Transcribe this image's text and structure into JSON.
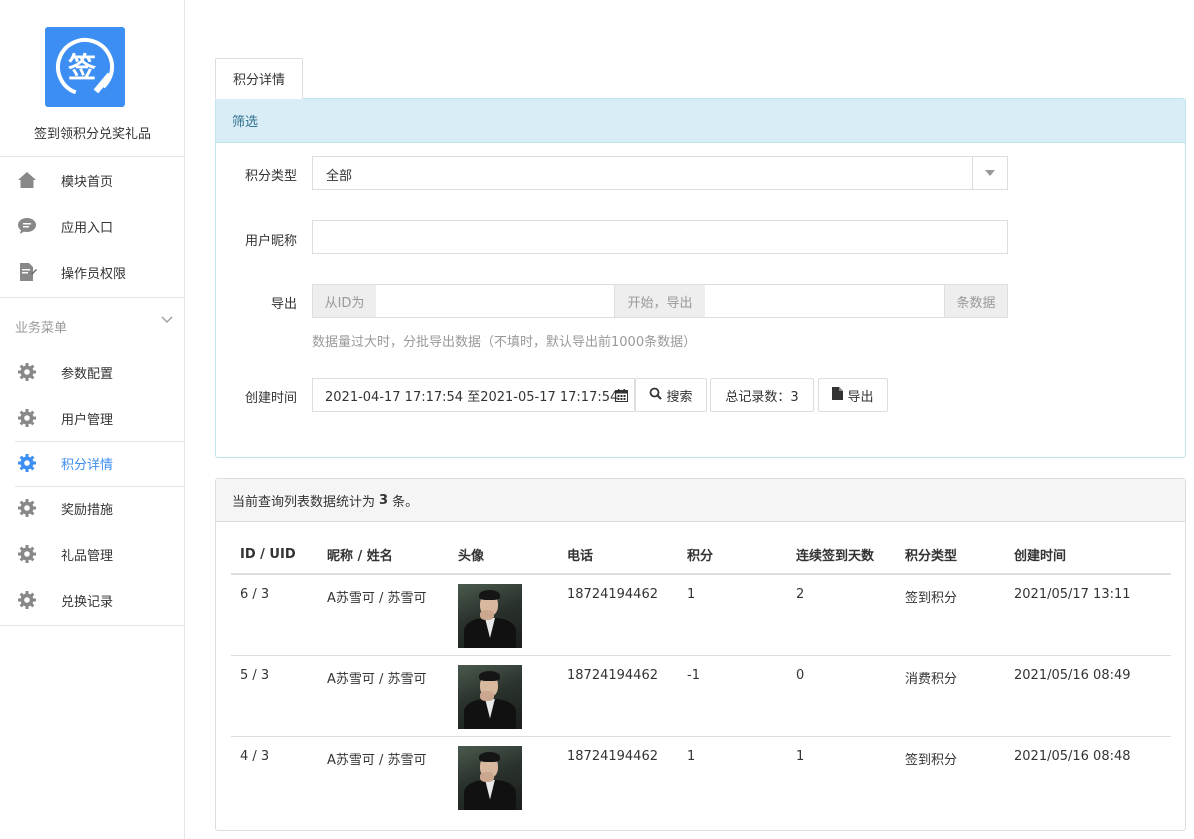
{
  "app": {
    "name": "签到领积分兑奖礼品",
    "logo_char": "签",
    "accent_color": "#3d8ef2"
  },
  "sidebar": {
    "top_items": [
      {
        "label": "模块首页",
        "icon": "home-icon"
      },
      {
        "label": "应用入口",
        "icon": "chat-icon"
      },
      {
        "label": "操作员权限",
        "icon": "document-edit-icon"
      }
    ],
    "group_title": "业务菜单",
    "group_items": [
      {
        "label": "参数配置",
        "icon": "gear-icon"
      },
      {
        "label": "用户管理",
        "icon": "gear-icon"
      },
      {
        "label": "积分详情",
        "icon": "gear-icon",
        "active": true
      },
      {
        "label": "奖励措施",
        "icon": "gear-icon"
      },
      {
        "label": "礼品管理",
        "icon": "gear-icon"
      },
      {
        "label": "兑换记录",
        "icon": "gear-icon"
      }
    ]
  },
  "tab": {
    "label": "积分详情"
  },
  "filter": {
    "title": "筛选",
    "points_type_label": "积分类型",
    "points_type_value": "全部",
    "nickname_label": "用户昵称",
    "nickname_value": "",
    "export_label": "导出",
    "export_from_addon": "从ID为",
    "export_from_value": "",
    "export_mid_addon": "开始，导出",
    "export_count_value": "",
    "export_end_addon": "条数据",
    "export_hint": "数据量过大时，分批导出数据（不填时，默认导出前1000条数据）",
    "created_label": "创建时间",
    "date_range": "2021-04-17 17:17:54 至2021-05-17 17:17:54",
    "search_button": "搜索",
    "total_label": "总记录数：3",
    "export_button": "导出"
  },
  "result": {
    "summary_prefix": "当前查询列表数据统计为",
    "summary_count": "3",
    "summary_suffix": "条。",
    "columns": [
      "ID / UID",
      "昵称 / 姓名",
      "头像",
      "电话",
      "积分",
      "连续签到天数",
      "积分类型",
      "创建时间"
    ],
    "rows": [
      {
        "id_uid": "6 / 3",
        "name": "A苏雪可 / 苏雪可",
        "phone": "18724194462",
        "points": "1",
        "streak": "2",
        "type": "签到积分",
        "created": "2021/05/17 13:11"
      },
      {
        "id_uid": "5 / 3",
        "name": "A苏雪可 / 苏雪可",
        "phone": "18724194462",
        "points": "-1",
        "streak": "0",
        "type": "消费积分",
        "created": "2021/05/16 08:49"
      },
      {
        "id_uid": "4 / 3",
        "name": "A苏雪可 / 苏雪可",
        "phone": "18724194462",
        "points": "1",
        "streak": "1",
        "type": "签到积分",
        "created": "2021/05/16 08:48"
      }
    ]
  }
}
